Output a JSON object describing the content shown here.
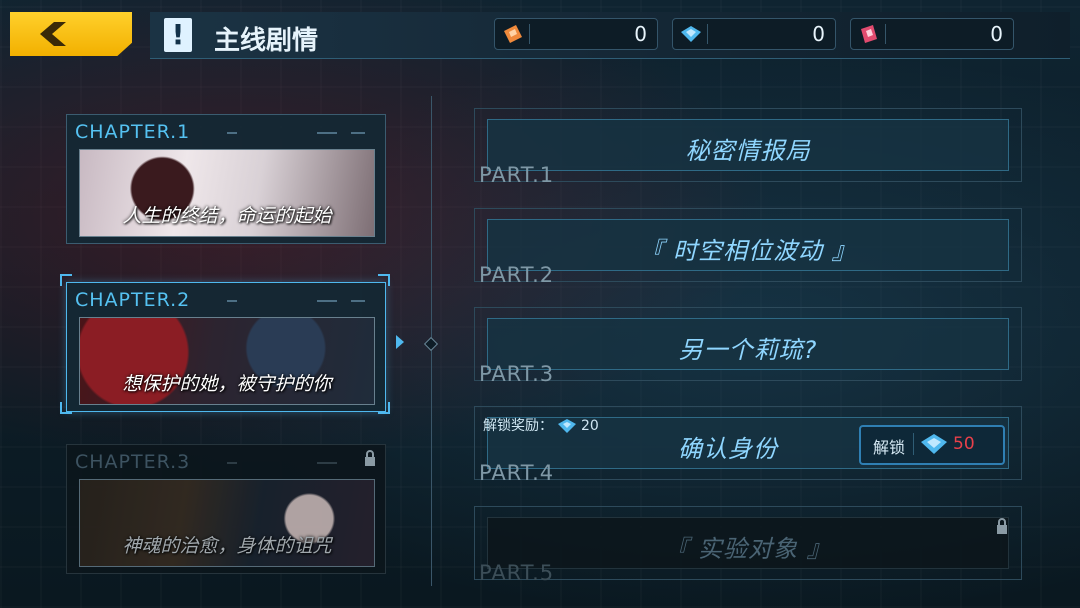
{
  "header": {
    "title": "主线剧情",
    "currencies": [
      {
        "icon": "orange-ticket-icon",
        "value": "0",
        "color": "#f08a3c"
      },
      {
        "icon": "blue-crystal-icon",
        "value": "0",
        "color": "#4fb8ee"
      },
      {
        "icon": "pink-ticket-icon",
        "value": "0",
        "color": "#e24b6f"
      }
    ]
  },
  "chapters": [
    {
      "label": "CHAPTER.1",
      "subtitle": "人生的终结，命运的起始",
      "state": "normal"
    },
    {
      "label": "CHAPTER.2",
      "subtitle": "想保护的她，被守护的你",
      "state": "selected"
    },
    {
      "label": "CHAPTER.3",
      "subtitle": "神魂的治愈，身体的诅咒",
      "state": "locked"
    }
  ],
  "parts": [
    {
      "label": "PART.1",
      "title": "秘密情报局",
      "state": "unlocked"
    },
    {
      "label": "PART.2",
      "title": "『 时空相位波动 』",
      "state": "unlocked"
    },
    {
      "label": "PART.3",
      "title": "另一个莉琉?",
      "state": "unlocked"
    },
    {
      "label": "PART.4",
      "title": "确认身份",
      "state": "purchasable",
      "reward_label": "解锁奖励：",
      "reward_amount": "20",
      "unlock_label": "解锁",
      "unlock_cost": "50"
    },
    {
      "label": "PART.5",
      "title": "『 实验对象 』",
      "state": "locked"
    }
  ]
}
